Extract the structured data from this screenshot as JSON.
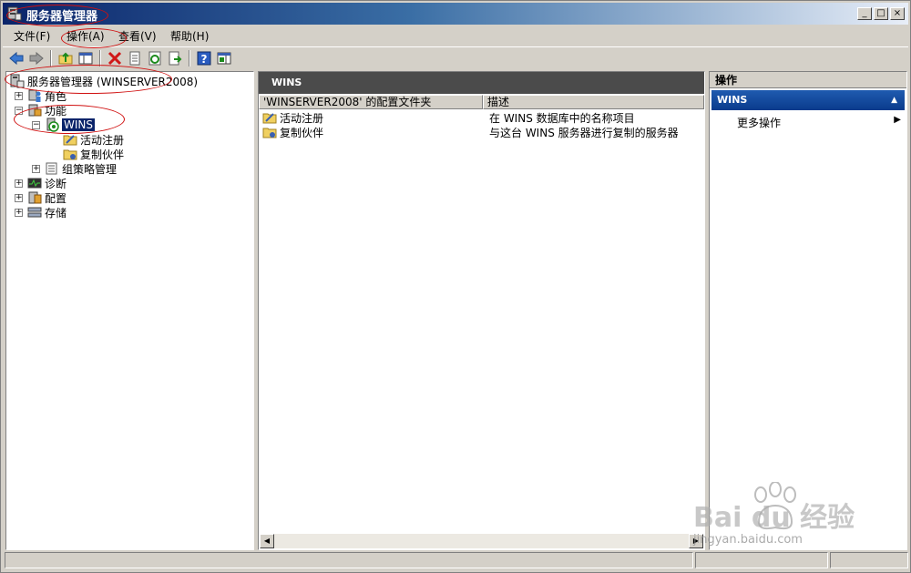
{
  "window": {
    "title": "服务器管理器",
    "buttons": {
      "minimize": "_",
      "maximize": "□",
      "close": "×"
    }
  },
  "menu": [
    "文件(F)",
    "操作(A)",
    "查看(V)",
    "帮助(H)"
  ],
  "toolbar": {
    "icons": [
      "back-icon",
      "forward-icon",
      "up-folder-icon",
      "show-hide-tree-icon",
      "delete-icon",
      "properties-icon",
      "refresh-icon",
      "export-icon",
      "help-icon",
      "show-hide-action-pane-icon"
    ]
  },
  "tree": {
    "root": "服务器管理器 (WINSERVER2008)",
    "roles": "角色",
    "features": "功能",
    "wins": "WINS",
    "active_registrations": "活动注册",
    "replication_partners": "复制伙伴",
    "group_policy": "组策略管理",
    "diagnostics": "诊断",
    "configuration": "配置",
    "storage": "存储"
  },
  "center": {
    "header": "WINS",
    "columns": [
      "'WINSERVER2008' 的配置文件夹",
      "描述"
    ],
    "rows": [
      {
        "name": "活动注册",
        "desc": "在 WINS 数据库中的名称项目"
      },
      {
        "name": "复制伙伴",
        "desc": "与这台 WINS 服务器进行复制的服务器"
      }
    ]
  },
  "actions": {
    "title": "操作",
    "section": "WINS",
    "items": [
      "更多操作"
    ]
  },
  "watermark": {
    "brand": "Bai du 经验",
    "url": "jingyan.baidu.com"
  },
  "colors": {
    "title_bar": "#0a246a",
    "selection": "#0a246a",
    "action_section": "#1f5bb0",
    "annotation": "#d01010"
  }
}
